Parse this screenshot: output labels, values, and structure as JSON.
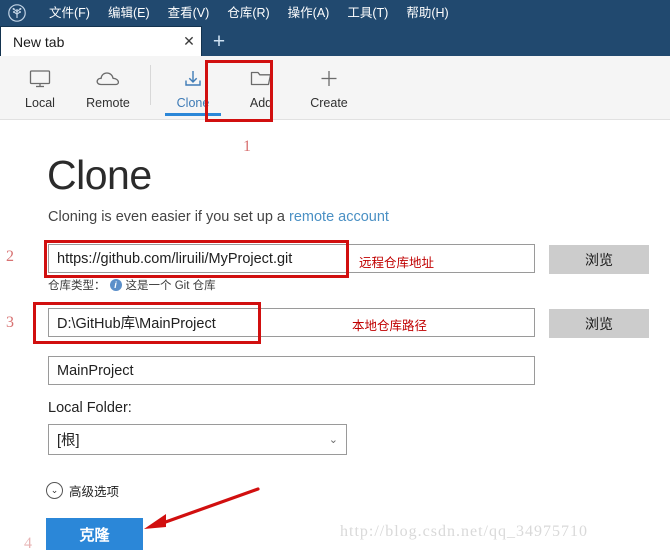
{
  "window": {
    "logo_icon": "sourcetree-logo-icon",
    "menu": [
      {
        "label": "文件(F)"
      },
      {
        "label": "编辑(E)"
      },
      {
        "label": "查看(V)"
      },
      {
        "label": "仓库(R)"
      },
      {
        "label": "操作(A)"
      },
      {
        "label": "工具(T)"
      },
      {
        "label": "帮助(H)"
      }
    ],
    "titlebar_color": "#21496f"
  },
  "tabs": {
    "active_tab_label": "New tab",
    "close_glyph": "✕",
    "new_tab_glyph": "+"
  },
  "toolbar": {
    "items": [
      {
        "label": "Local",
        "icon": "monitor-icon",
        "active": false
      },
      {
        "label": "Remote",
        "icon": "cloud-icon",
        "active": false
      },
      {
        "label": "Clone",
        "icon": "download-arrow-icon",
        "active": true
      },
      {
        "label": "Add",
        "icon": "folder-icon",
        "active": false
      },
      {
        "label": "Create",
        "icon": "plus-icon",
        "active": false
      }
    ],
    "accent_color": "#2b87d8"
  },
  "main": {
    "title": "Clone",
    "subtitle_prefix": "Cloning is even easier if you set up a ",
    "subtitle_link": "remote account",
    "remote_url": "https://github.com/liruili/MyProject.git",
    "browse_label_1": "浏览",
    "repo_type_label": "仓库类型：",
    "repo_type_value": "这是一个 Git 仓库",
    "repo_type_icon": "info-icon",
    "local_path": "D:\\GitHub库\\MainProject",
    "browse_label_2": "浏览",
    "project_name": "MainProject",
    "local_folder_label": "Local Folder:",
    "local_folder_value": "[根]",
    "local_folder_caret": "⌄",
    "advanced_label": "高级选项",
    "advanced_caret": "⌄",
    "clone_button_label": "克隆"
  },
  "annotations": {
    "num_1": "1",
    "num_2": "2",
    "num_3": "3",
    "num_4": "4",
    "label_remote_url": "远程仓库地址",
    "label_local_path": "本地仓库路径",
    "highlight_color": "#d10f0f"
  },
  "watermark": {
    "text": "http://blog.csdn.net/qq_34975710"
  }
}
